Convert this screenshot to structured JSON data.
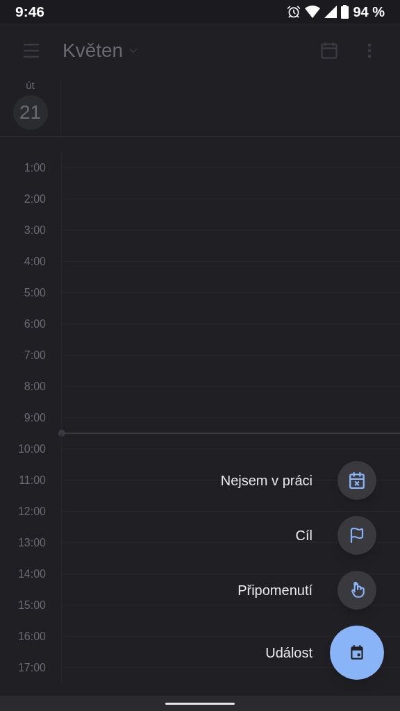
{
  "status_bar": {
    "time": "9:46",
    "battery": "94 %"
  },
  "app_bar": {
    "title": "Květen"
  },
  "day_header": {
    "weekday": "út",
    "date": "21"
  },
  "hours": [
    "1:00",
    "2:00",
    "3:00",
    "4:00",
    "5:00",
    "6:00",
    "7:00",
    "8:00",
    "9:00",
    "10:00",
    "11:00",
    "12:00",
    "13:00",
    "14:00",
    "15:00",
    "16:00",
    "17:00"
  ],
  "fab_menu": [
    {
      "label": "Nejsem v práci",
      "kind": "out_of_office"
    },
    {
      "label": "Cíl",
      "kind": "goal"
    },
    {
      "label": "Připomenutí",
      "kind": "reminder"
    },
    {
      "label": "Událost",
      "kind": "event"
    }
  ]
}
